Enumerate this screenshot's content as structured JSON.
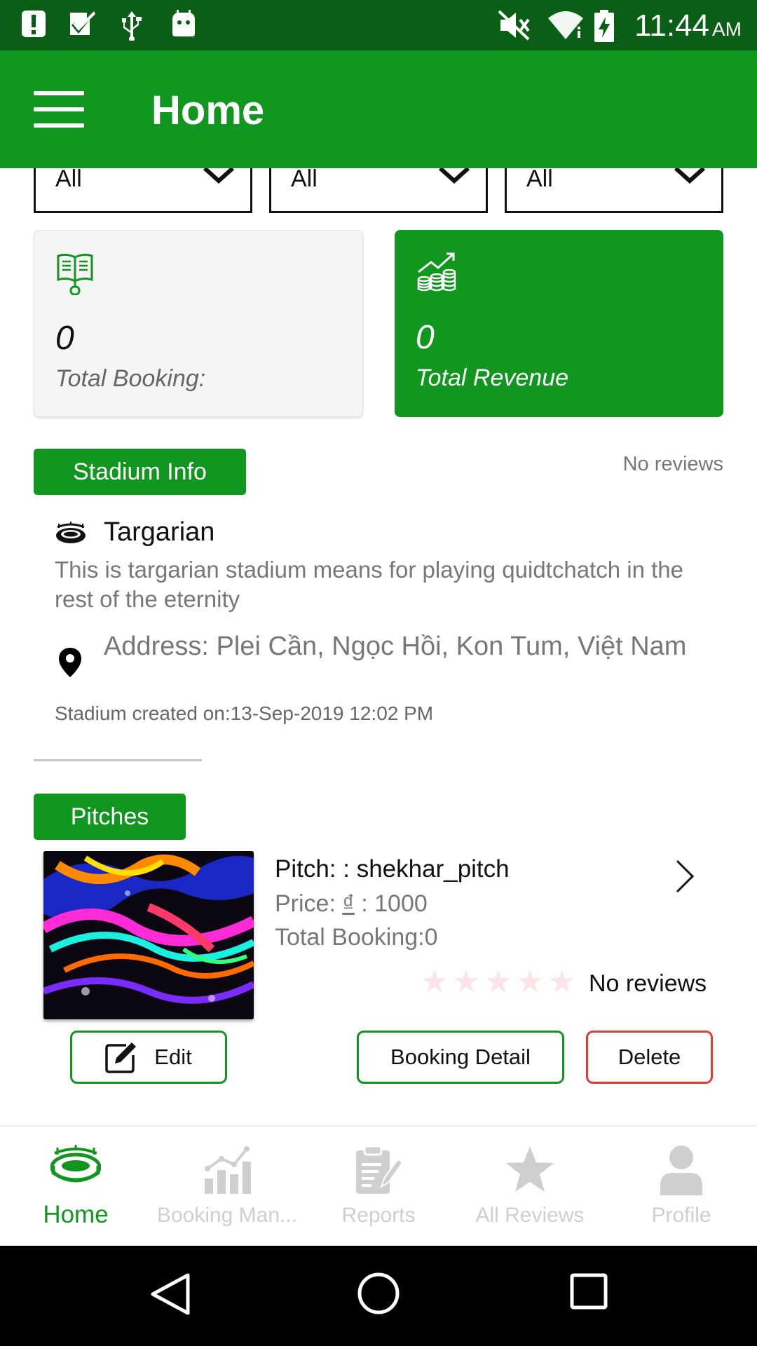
{
  "status_bar": {
    "time": "11:44",
    "ampm": "AM",
    "icons": [
      "alert-icon",
      "check-box-icon",
      "usb-icon",
      "android-icon",
      "mute-icon",
      "wifi-icon",
      "battery-charging-icon"
    ]
  },
  "app_bar": {
    "title": "Home",
    "menu_icon": "hamburger-menu-icon"
  },
  "filters": [
    {
      "value": "All"
    },
    {
      "value": "All"
    },
    {
      "value": "All"
    }
  ],
  "stats": {
    "booking": {
      "value": "0",
      "label": "Total Booking:",
      "icon": "booking-book-icon"
    },
    "revenue": {
      "value": "0",
      "label": "Total Revenue",
      "icon": "revenue-coins-icon"
    }
  },
  "stadium": {
    "section_label": "Stadium Info",
    "reviews_text": "No reviews",
    "name": "Targarian",
    "description": "This is targarian stadium means for playing quidtchatch in the rest of the eternity",
    "address": "Address: Plei Cần, Ngọc Hồi, Kon Tum, Việt Nam",
    "created": "Stadium created on:13-Sep-2019 12:02 PM"
  },
  "pitches": {
    "section_label": "Pitches",
    "items": [
      {
        "name": "Pitch: : shekhar_pitch",
        "price_prefix": "Price: ",
        "currency": "₫",
        "price_suffix": " : 1000",
        "total_booking": "Total Booking:0",
        "rating": 0,
        "max_rating": 5,
        "reviews_text": "No reviews",
        "edit_label": "Edit",
        "booking_detail_label": "Booking Detail",
        "delete_label": "Delete"
      }
    ]
  },
  "bottom_nav": [
    {
      "label": "Home",
      "icon": "stadium-icon",
      "active": true
    },
    {
      "label": "Booking Man...",
      "icon": "bar-chart-icon",
      "active": false
    },
    {
      "label": "Reports",
      "icon": "clipboard-icon",
      "active": false
    },
    {
      "label": "All Reviews",
      "icon": "star-icon",
      "active": false
    },
    {
      "label": "Profile",
      "icon": "person-icon",
      "active": false
    }
  ],
  "colors": {
    "primary": "#11961f",
    "status_bar": "#0b5e15",
    "delete": "#e03a3a",
    "inactive_nav": "#cfcfcf"
  }
}
